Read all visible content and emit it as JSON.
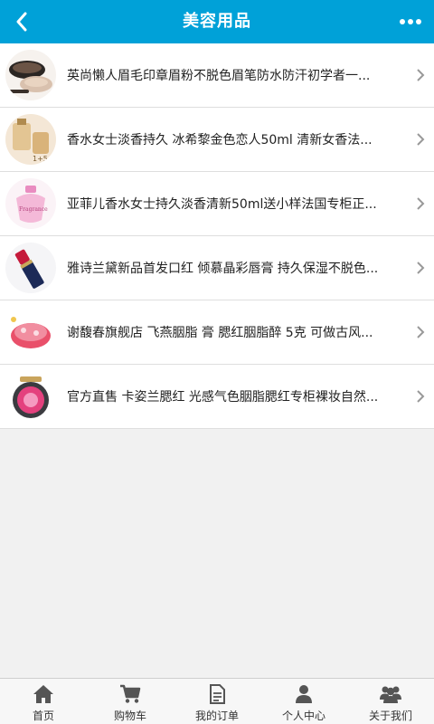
{
  "header": {
    "title": "美容用品",
    "back_icon": "back-arrow-icon",
    "more_icon": "more-dots-icon"
  },
  "products": [
    {
      "title": "英尚懒人眉毛印章眉粉不脱色眉笔防水防汗初学者一..."
    },
    {
      "title": "香水女士淡香持久 冰希黎金色恋人50ml 清新女香法..."
    },
    {
      "title": "亚菲儿香水女士持久淡香清新50ml送小样法国专柜正..."
    },
    {
      "title": "雅诗兰黛新品首发口红 倾慕晶彩唇膏 持久保湿不脱色..."
    },
    {
      "title": "谢馥春旗舰店 飞燕胭脂 膏 腮红胭脂醉 5克 可做古风..."
    },
    {
      "title": "官方直售 卡姿兰腮红 光感气色胭脂腮红专柜裸妆自然..."
    }
  ],
  "thumb_text": {
    "p2": "1+5",
    "p3": "Fragrance"
  },
  "tabs": [
    {
      "label": "首页",
      "icon": "home-icon"
    },
    {
      "label": "购物车",
      "icon": "cart-icon"
    },
    {
      "label": "我的订单",
      "icon": "order-icon"
    },
    {
      "label": "个人中心",
      "icon": "user-icon"
    },
    {
      "label": "关于我们",
      "icon": "group-icon"
    }
  ],
  "colors": {
    "header_bg": "#00a1d8",
    "page_bg": "#f1f1f1",
    "tab_icon": "#555555"
  }
}
